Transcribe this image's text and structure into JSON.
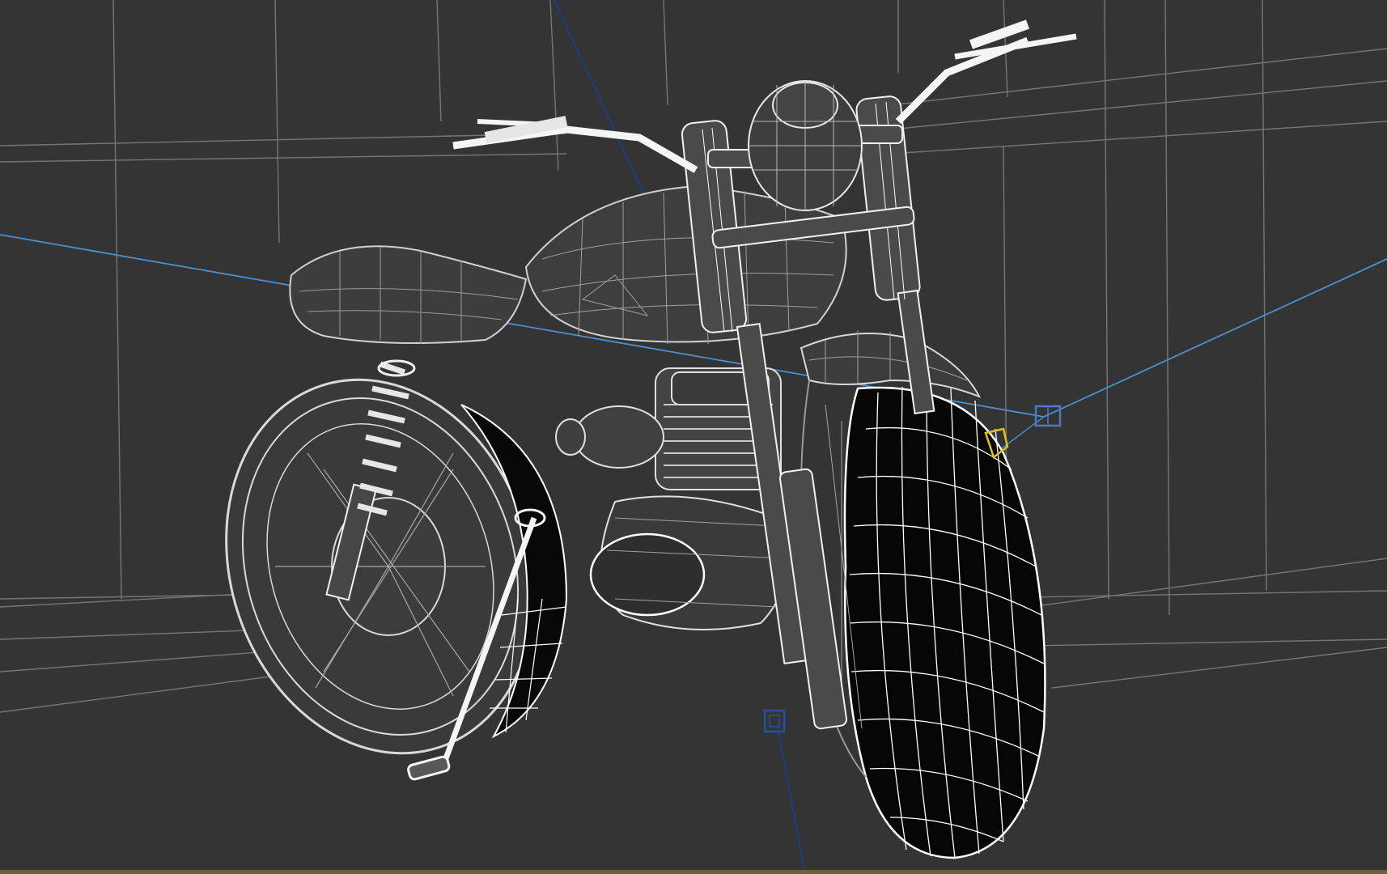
{
  "viewport": {
    "background_color": "#343434",
    "grid_color": "#8c8c8c",
    "wire_color": "#d9d9d9",
    "wire_highlight_color": "#ffffff",
    "tire_fill_color": "#050505",
    "camera_line_color": "#4a90d0",
    "axis_line_color": "#1e3c78",
    "selected_gizmo_color": "#e0c020",
    "bottom_border_color": "#6b6239"
  },
  "scene": {
    "object_name": "motorcycle-wireframe",
    "display_mode": "wireframe"
  }
}
